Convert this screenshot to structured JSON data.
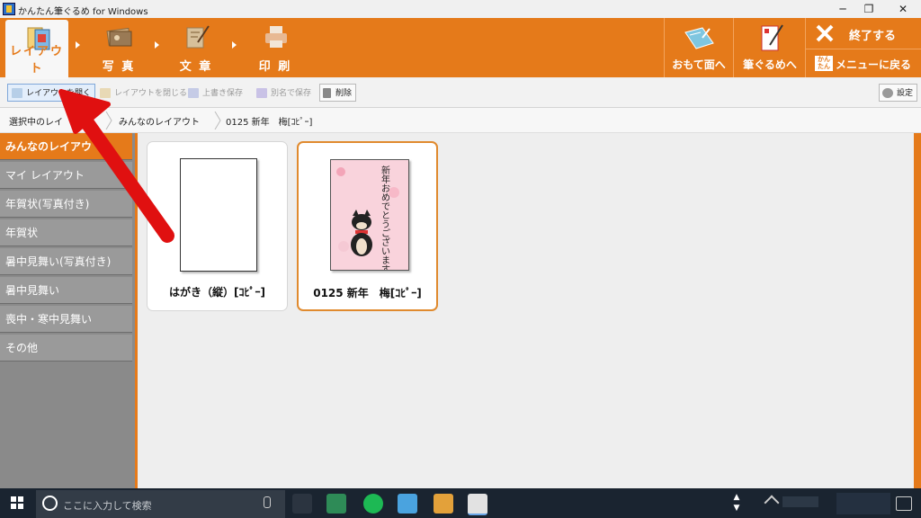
{
  "window": {
    "title": "かんたん筆ぐるめ for Windows",
    "controls": [
      "─",
      "❐",
      "✕"
    ]
  },
  "steps": [
    {
      "label": "レイアウト"
    },
    {
      "label": "写 真"
    },
    {
      "label": "文 章"
    },
    {
      "label": "印 刷"
    }
  ],
  "ribbon_right": {
    "omote": "おもて面へ",
    "fudegurume": "筆ぐるめへ",
    "exit": "終了する",
    "menu_badge": "かんたん",
    "menu": "メニューに戻る"
  },
  "toolbar": {
    "open": "レイアウトを開く",
    "close": "レイアウトを閉じる",
    "overwrite": "上書き保存",
    "save_as": "別名で保存",
    "delete": "削除",
    "settings": "設定"
  },
  "breadcrumb": [
    "選択中のレイ",
    "みんなのレイアウト",
    "0125 新年　梅[ｺﾋﾟｰ]"
  ],
  "sidebar": {
    "items": [
      {
        "label": "みんなのレイアウ"
      },
      {
        "label": "マイ レイアウト"
      },
      {
        "label": "年賀状(写真付き)"
      },
      {
        "label": "年賀状"
      },
      {
        "label": "暑中見舞い(写真付き)"
      },
      {
        "label": "暑中見舞い"
      },
      {
        "label": "喪中・寒中見舞い"
      },
      {
        "label": "その他"
      }
    ],
    "selected_index": 0
  },
  "layouts": [
    {
      "label": "はがき（縦）[ｺﾋﾟｰ]"
    },
    {
      "label": "0125 新年　梅[ｺﾋﾟｰ]",
      "card_text": "新年おめでとうございます"
    }
  ],
  "taskbar": {
    "search_placeholder": "ここに入力して検索"
  },
  "colors": {
    "accent_orange": "#e57a1a",
    "annotation_red": "#e01010",
    "taskbar": "#1a2430"
  }
}
